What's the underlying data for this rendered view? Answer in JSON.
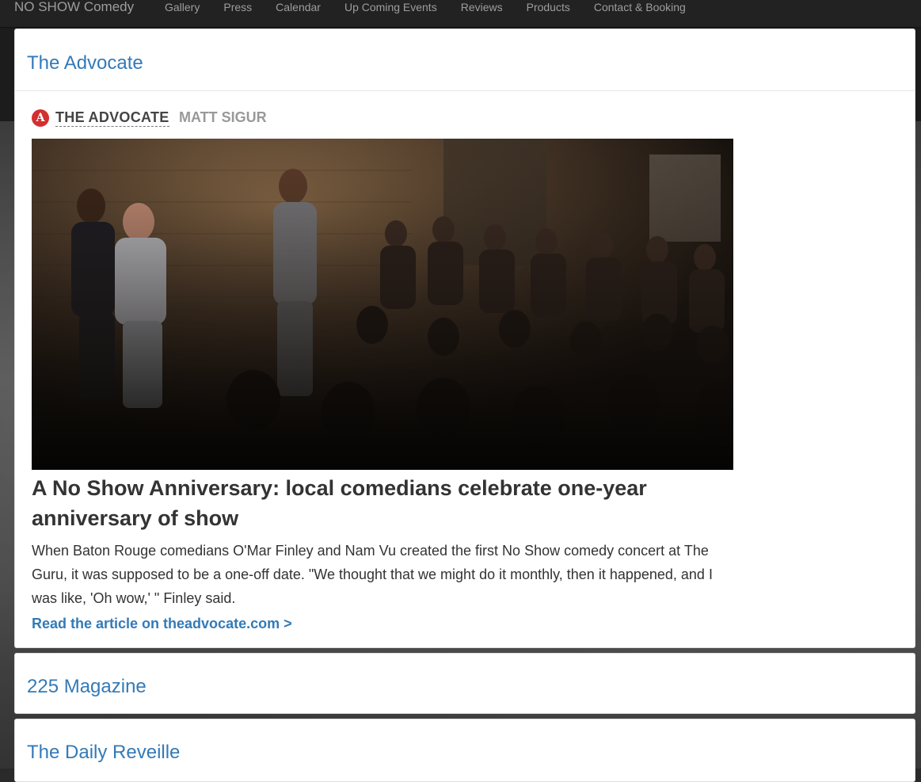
{
  "navbar": {
    "brand": "NO SHOW Comedy",
    "items": [
      {
        "label": "Gallery"
      },
      {
        "label": "Press"
      },
      {
        "label": "Calendar"
      },
      {
        "label": "Up Coming Events"
      },
      {
        "label": "Reviews"
      },
      {
        "label": "Products"
      },
      {
        "label": "Contact & Booking"
      }
    ]
  },
  "panels": [
    {
      "title": "The Advocate",
      "article": {
        "source_logo": "A",
        "source_name": "THE ADVOCATE",
        "author": "MATT SIGUR",
        "headline": "A No Show Anniversary: local comedians celebrate one-year anniversary of show",
        "summary": "When Baton Rouge comedians O'Mar Finley and Nam Vu created the first No Show comedy concert at The Guru, it was supposed to be a one-off date. \"We thought that we might do it monthly, then it happened, and I was like, 'Oh wow,' \" Finley said.",
        "read_more": "Read the article on theadvocate.com >"
      }
    },
    {
      "title": "225 Magazine"
    },
    {
      "title": "The Daily Reveille"
    }
  ],
  "colors": {
    "navbar_bg": "#222222",
    "link_blue": "#337ab7",
    "nav_text": "#9d9d9d",
    "advocate_red": "#d32f2f"
  }
}
